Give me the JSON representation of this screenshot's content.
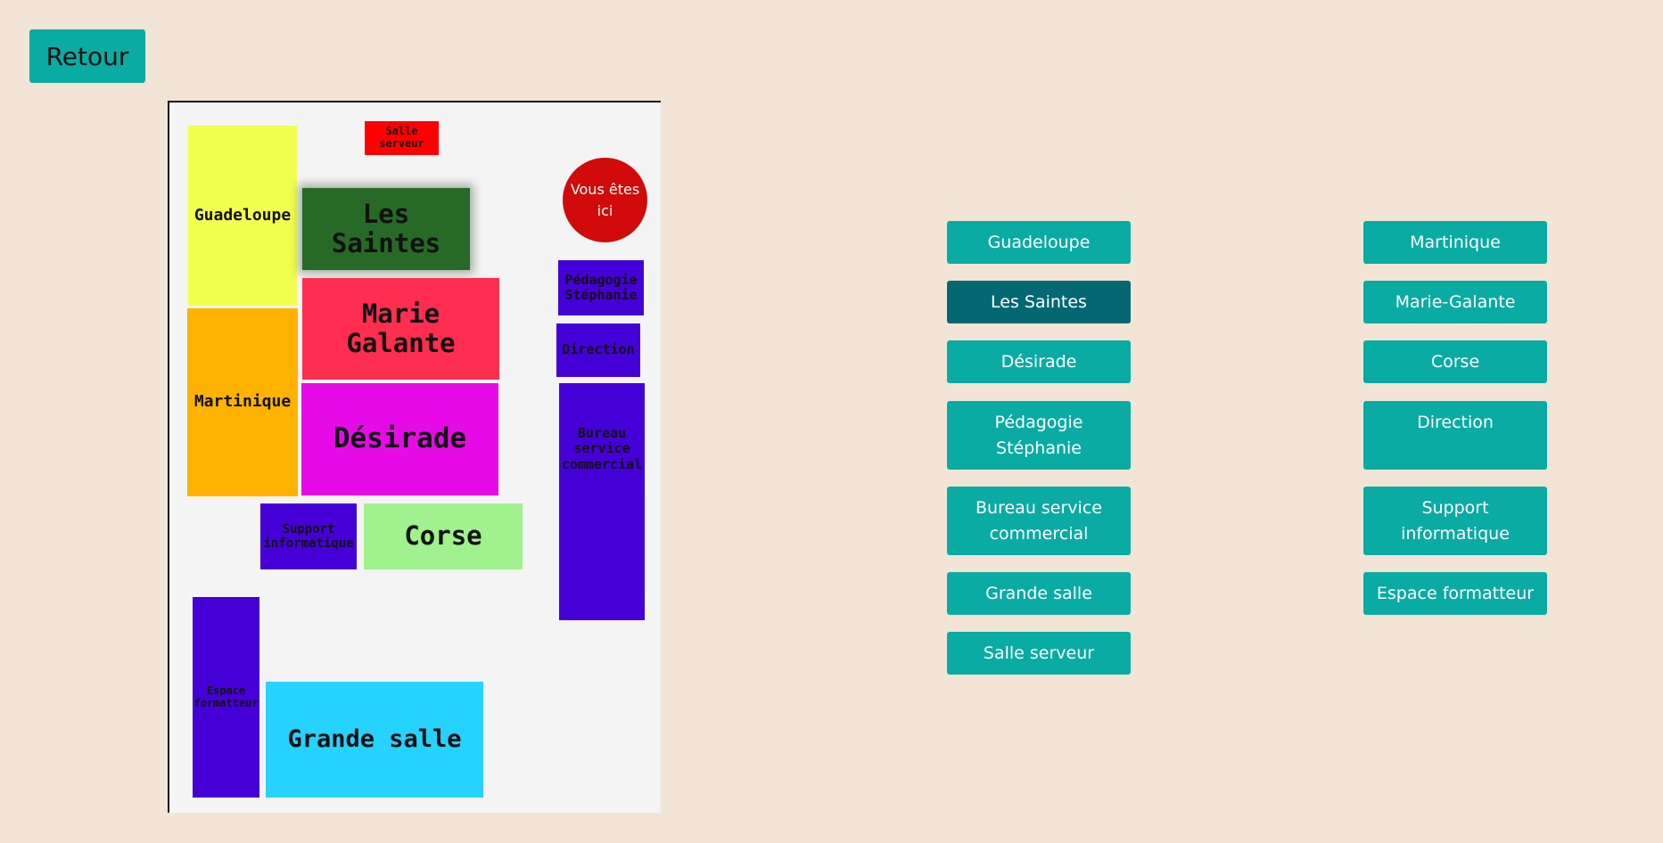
{
  "header": {
    "back_label": "Retour"
  },
  "floorplan": {
    "you_are_here": "Vous êtes ici",
    "rooms": {
      "guadeloupe": "Guadeloupe",
      "salle_serveur": "Salle serveur",
      "les_saintes": "Les Saintes",
      "marie_galante": "Marie Galante",
      "martinique": "Martinique",
      "desirade": "Désirade",
      "pedagogie": "Pédagogie Stéphanie",
      "direction": "Direction",
      "bureau_commercial": "Bureau service commercial",
      "support": "Support informatique",
      "corse": "Corse",
      "espace_formatteur": "Espace formatteur",
      "grande_salle": "Grande salle"
    },
    "colors": {
      "guadeloupe": "#f1ff4f",
      "salle_serveur": "#ff0000",
      "les_saintes": "#276a27",
      "marie_galante": "#ff2d4f",
      "martinique": "#ffb300",
      "desirade": "#e60be6",
      "violet_rooms": "#4400d6",
      "corse": "#9ff28d",
      "grande_salle": "#26d2ff"
    }
  },
  "room_buttons": {
    "left": [
      "Guadeloupe",
      "Les Saintes",
      "Désirade",
      "Pédagogie Stéphanie",
      "Bureau service commercial",
      "Grande salle",
      "Salle serveur"
    ],
    "right": [
      "Martinique",
      "Marie-Galante",
      "Corse",
      "Direction",
      "Support informatique",
      "Espace formatteur"
    ],
    "active": "Les Saintes",
    "accent_color": "#0aaba3",
    "active_color": "#046872"
  }
}
